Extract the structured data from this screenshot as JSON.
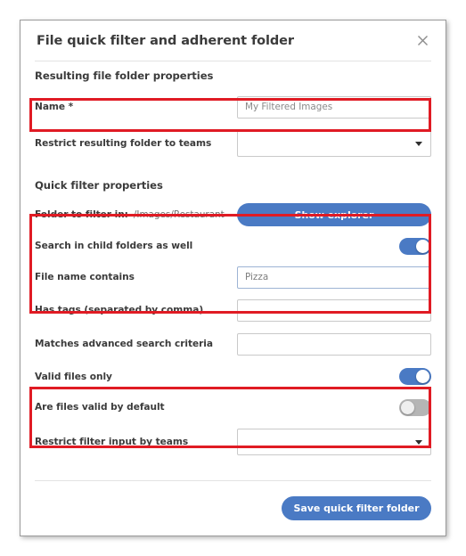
{
  "dialog": {
    "title": "File quick filter and adherent folder",
    "close_icon": "close-icon"
  },
  "sections": {
    "resulting": {
      "heading": "Resulting file folder properties",
      "name_row": {
        "label": "Name *",
        "input_value": "My Filtered Images",
        "input_placeholder": "My Filtered Images"
      },
      "restrict_folder_row": {
        "label": "Restrict resulting folder to teams",
        "selected": "",
        "caret_icon": "chevron-down-icon"
      }
    },
    "quickfilter": {
      "heading": "Quick filter properties",
      "folder_row": {
        "label": "Folder to filter in:",
        "value": "/Images/Restaurant",
        "button_label": "Show explorer"
      },
      "child_folders_row": {
        "label": "Search in child folders as well",
        "state": "on"
      },
      "filename_row": {
        "label": "File name contains",
        "input_value": "Pizza",
        "input_placeholder": "Pizza"
      },
      "tags_row": {
        "label": "Has tags (separated by comma)",
        "input_value": "",
        "input_placeholder": ""
      },
      "advanced_row": {
        "label": "Matches advanced search criteria",
        "input_value": "",
        "input_placeholder": ""
      },
      "valid_only_row": {
        "label": "Valid files only",
        "state": "on"
      },
      "valid_default_row": {
        "label": "Are files valid by default",
        "state": "off"
      },
      "restrict_input_row": {
        "label": "Restrict filter input by teams",
        "selected": "",
        "caret_icon": "chevron-down-icon"
      }
    }
  },
  "footer": {
    "save_label": "Save quick filter folder"
  },
  "colors": {
    "accent_blue": "#4a7ac4",
    "annotation_red": "#e01b24",
    "label_text": "#3b3b3b",
    "placeholder_text": "#8a8a8a",
    "border_gray": "#c9c9c9",
    "toggle_off_gray": "#b5b5b5"
  }
}
